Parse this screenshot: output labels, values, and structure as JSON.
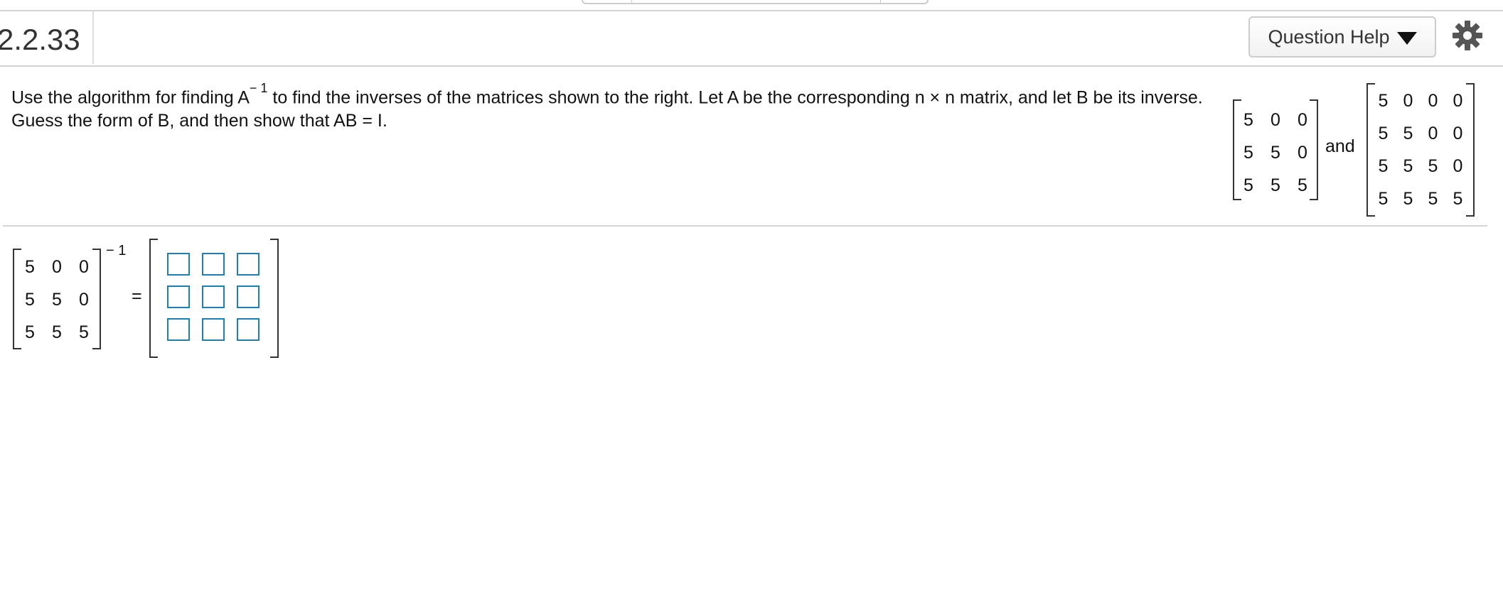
{
  "header": {
    "question_number": "2.2.33",
    "help_button_label": "Question Help",
    "help_dropdown_icon": "triangle-down-icon",
    "settings_icon": "gear-icon"
  },
  "prompt": {
    "text_before_superscript": "Use the algorithm for finding A",
    "superscript": "− 1",
    "text_after_superscript": " to find the inverses of the matrices shown to the right. Let A be the corresponding n × n matrix, and let B be its inverse. Guess the form of B, and then show that AB = I."
  },
  "given_matrices": {
    "matrix_3x3": [
      [
        "5",
        "0",
        "0"
      ],
      [
        "5",
        "5",
        "0"
      ],
      [
        "5",
        "5",
        "5"
      ]
    ],
    "connector": "and",
    "matrix_4x4": [
      [
        "5",
        "0",
        "0",
        "0"
      ],
      [
        "5",
        "5",
        "0",
        "0"
      ],
      [
        "5",
        "5",
        "5",
        "0"
      ],
      [
        "5",
        "5",
        "5",
        "5"
      ]
    ]
  },
  "answer": {
    "matrix": [
      [
        "5",
        "0",
        "0"
      ],
      [
        "5",
        "5",
        "0"
      ],
      [
        "5",
        "5",
        "5"
      ]
    ],
    "exponent": "− 1",
    "equals": "=",
    "input_values": [
      [
        "",
        "",
        ""
      ],
      [
        "",
        "",
        ""
      ],
      [
        "",
        "",
        ""
      ]
    ],
    "input_border_color": "#1e7fb0"
  }
}
